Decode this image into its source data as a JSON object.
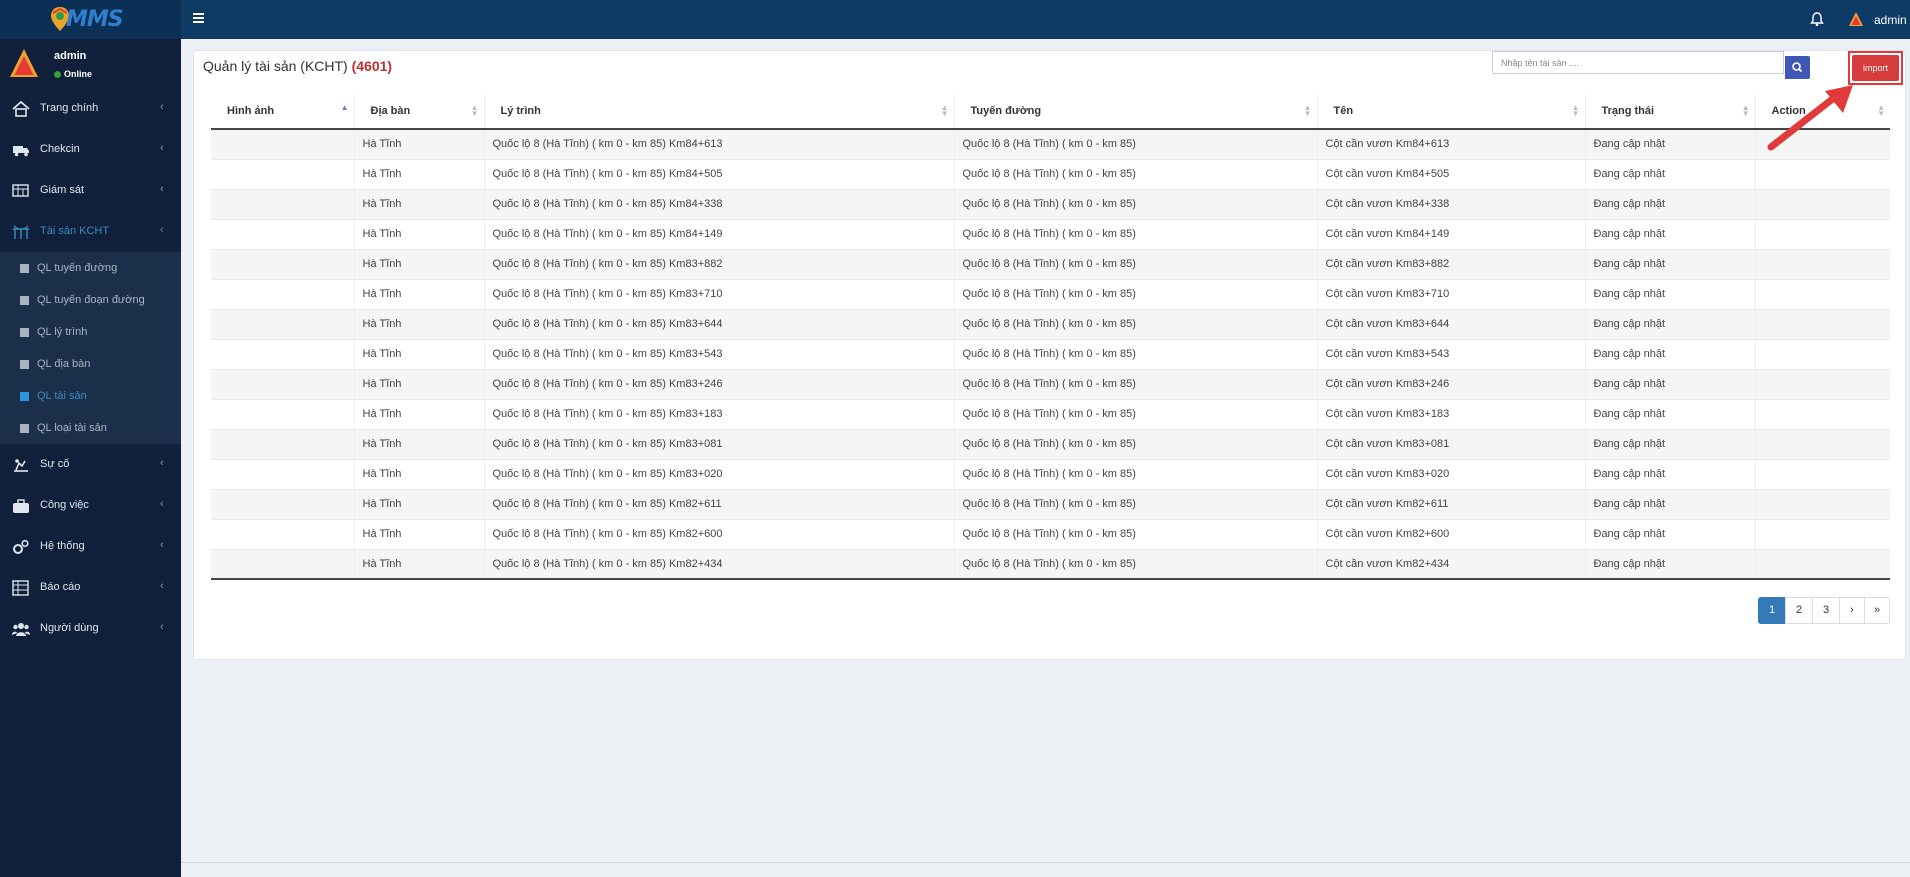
{
  "app": {
    "logo_text": "MMS",
    "user": "admin"
  },
  "sidebar": {
    "user": {
      "name": "admin",
      "status": "Online"
    },
    "items": [
      {
        "label": "Trang chính",
        "icon": "home-icon"
      },
      {
        "label": "Chekcin",
        "icon": "truck-icon"
      },
      {
        "label": "Giám sát",
        "icon": "monitor-icon"
      },
      {
        "label": "Tài sản KCHT",
        "icon": "road-sign-icon",
        "active": true
      },
      {
        "label": "Sự cố",
        "icon": "incident-icon"
      },
      {
        "label": "Công việc",
        "icon": "briefcase-icon"
      },
      {
        "label": "Hệ thống",
        "icon": "gears-icon"
      },
      {
        "label": "Báo cáo",
        "icon": "report-icon"
      },
      {
        "label": "Người dùng",
        "icon": "users-icon"
      }
    ],
    "submenu": [
      {
        "label": "QL tuyến đường"
      },
      {
        "label": "QL tuyến đoạn đường"
      },
      {
        "label": "QL lý trình"
      },
      {
        "label": "QL địa bàn"
      },
      {
        "label": "QL tài sản",
        "active": true
      },
      {
        "label": "QL loại tài sản"
      }
    ]
  },
  "main": {
    "title": "Quản lý tài sản (KCHT)",
    "count": "(4601)",
    "search_placeholder": "Nhập tên tài sản ....",
    "import_label": "import",
    "columns": [
      "Hình ảnh",
      "Địa bàn",
      "Lý trình",
      "Tuyến đường",
      "Tên",
      "Trạng thái",
      "Action"
    ],
    "rows": [
      {
        "image": "",
        "area": "Hà Tĩnh",
        "route_point": "Quốc lộ 8 (Hà Tĩnh) ( km 0 - km 85) Km84+613",
        "road": "Quốc lộ 8 (Hà Tĩnh) ( km 0 - km 85)",
        "name": "Cột cần vươn Km84+613",
        "status": "Đang cập nhật",
        "action": ""
      },
      {
        "image": "",
        "area": "Hà Tĩnh",
        "route_point": "Quốc lộ 8 (Hà Tĩnh) ( km 0 - km 85) Km84+505",
        "road": "Quốc lộ 8 (Hà Tĩnh) ( km 0 - km 85)",
        "name": "Cột cần vươn Km84+505",
        "status": "Đang cập nhật",
        "action": ""
      },
      {
        "image": "",
        "area": "Hà Tĩnh",
        "route_point": "Quốc lộ 8 (Hà Tĩnh) ( km 0 - km 85) Km84+338",
        "road": "Quốc lộ 8 (Hà Tĩnh) ( km 0 - km 85)",
        "name": "Cột cần vươn Km84+338",
        "status": "Đang cập nhật",
        "action": ""
      },
      {
        "image": "",
        "area": "Hà Tĩnh",
        "route_point": "Quốc lộ 8 (Hà Tĩnh) ( km 0 - km 85) Km84+149",
        "road": "Quốc lộ 8 (Hà Tĩnh) ( km 0 - km 85)",
        "name": "Cột cần vươn Km84+149",
        "status": "Đang cập nhật",
        "action": ""
      },
      {
        "image": "",
        "area": "Hà Tĩnh",
        "route_point": "Quốc lộ 8 (Hà Tĩnh) ( km 0 - km 85) Km83+882",
        "road": "Quốc lộ 8 (Hà Tĩnh) ( km 0 - km 85)",
        "name": "Cột cần vươn Km83+882",
        "status": "Đang cập nhật",
        "action": ""
      },
      {
        "image": "",
        "area": "Hà Tĩnh",
        "route_point": "Quốc lộ 8 (Hà Tĩnh) ( km 0 - km 85) Km83+710",
        "road": "Quốc lộ 8 (Hà Tĩnh) ( km 0 - km 85)",
        "name": "Cột cần vươn Km83+710",
        "status": "Đang cập nhật",
        "action": ""
      },
      {
        "image": "",
        "area": "Hà Tĩnh",
        "route_point": "Quốc lộ 8 (Hà Tĩnh) ( km 0 - km 85) Km83+644",
        "road": "Quốc lộ 8 (Hà Tĩnh) ( km 0 - km 85)",
        "name": "Cột cần vươn Km83+644",
        "status": "Đang cập nhật",
        "action": ""
      },
      {
        "image": "",
        "area": "Hà Tĩnh",
        "route_point": "Quốc lộ 8 (Hà Tĩnh) ( km 0 - km 85) Km83+543",
        "road": "Quốc lộ 8 (Hà Tĩnh) ( km 0 - km 85)",
        "name": "Cột cần vươn Km83+543",
        "status": "Đang cập nhật",
        "action": ""
      },
      {
        "image": "",
        "area": "Hà Tĩnh",
        "route_point": "Quốc lộ 8 (Hà Tĩnh) ( km 0 - km 85) Km83+246",
        "road": "Quốc lộ 8 (Hà Tĩnh) ( km 0 - km 85)",
        "name": "Cột cần vươn Km83+246",
        "status": "Đang cập nhật",
        "action": ""
      },
      {
        "image": "",
        "area": "Hà Tĩnh",
        "route_point": "Quốc lộ 8 (Hà Tĩnh) ( km 0 - km 85) Km83+183",
        "road": "Quốc lộ 8 (Hà Tĩnh) ( km 0 - km 85)",
        "name": "Cột cần vươn Km83+183",
        "status": "Đang cập nhật",
        "action": ""
      },
      {
        "image": "",
        "area": "Hà Tĩnh",
        "route_point": "Quốc lộ 8 (Hà Tĩnh) ( km 0 - km 85) Km83+081",
        "road": "Quốc lộ 8 (Hà Tĩnh) ( km 0 - km 85)",
        "name": "Cột cần vươn Km83+081",
        "status": "Đang cập nhật",
        "action": ""
      },
      {
        "image": "",
        "area": "Hà Tĩnh",
        "route_point": "Quốc lộ 8 (Hà Tĩnh) ( km 0 - km 85) Km83+020",
        "road": "Quốc lộ 8 (Hà Tĩnh) ( km 0 - km 85)",
        "name": "Cột cần vươn Km83+020",
        "status": "Đang cập nhật",
        "action": ""
      },
      {
        "image": "",
        "area": "Hà Tĩnh",
        "route_point": "Quốc lộ 8 (Hà Tĩnh) ( km 0 - km 85) Km82+611",
        "road": "Quốc lộ 8 (Hà Tĩnh) ( km 0 - km 85)",
        "name": "Cột cần vươn Km82+611",
        "status": "Đang cập nhật",
        "action": ""
      },
      {
        "image": "",
        "area": "Hà Tĩnh",
        "route_point": "Quốc lộ 8 (Hà Tĩnh) ( km 0 - km 85) Km82+600",
        "road": "Quốc lộ 8 (Hà Tĩnh) ( km 0 - km 85)",
        "name": "Cột cần vươn Km82+600",
        "status": "Đang cập nhật",
        "action": ""
      },
      {
        "image": "",
        "area": "Hà Tĩnh",
        "route_point": "Quốc lộ 8 (Hà Tĩnh) ( km 0 - km 85) Km82+434",
        "road": "Quốc lộ 8 (Hà Tĩnh) ( km 0 - km 85)",
        "name": "Cột cần vươn Km82+434",
        "status": "Đang cập nhật",
        "action": ""
      }
    ],
    "pagination": [
      "1",
      "2",
      "3",
      "›",
      "»"
    ],
    "current_page": "1"
  },
  "colors": {
    "header": "#0e3a66",
    "sidebar": "#10203a",
    "accent": "#337ab7",
    "import": "#d73c3c",
    "count": "#b8312f"
  }
}
